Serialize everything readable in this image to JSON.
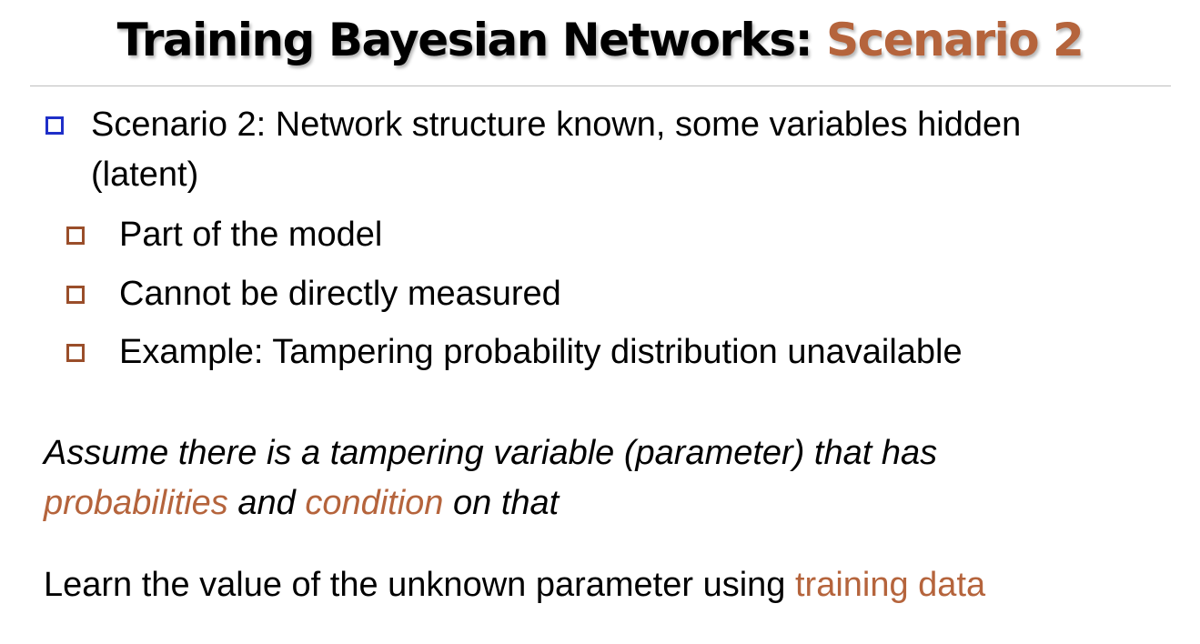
{
  "title": {
    "main": "Training Bayesian Networks: ",
    "accent": "Scenario 2"
  },
  "bullets": {
    "main": {
      "line1": "Scenario 2: Network structure known, some variables hidden",
      "line2": "(latent)"
    },
    "sub": [
      "Part of the model",
      "Cannot be directly measured",
      "Example: Tampering probability distribution unavailable"
    ]
  },
  "assume": {
    "line1": "Assume there is a tampering variable (parameter) that has",
    "hl1": "probabilities",
    "mid": " and ",
    "hl2": "condition",
    "end": " on that"
  },
  "learn": {
    "text": "Learn the value of the unknown parameter using ",
    "hl": "training data"
  },
  "colors": {
    "accent": "#b5643c",
    "bullet_level1": "#1f2fc8",
    "bullet_level2": "#9a4e2a"
  }
}
